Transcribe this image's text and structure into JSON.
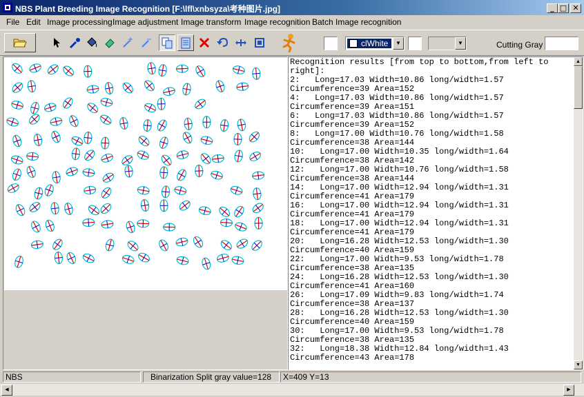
{
  "window": {
    "title": "NBS Plant Breeding Image Recognition [F:\\lfl\\xnbsyza\\考种图片.jpg]",
    "controls": {
      "minimize": "_",
      "maximize": "□",
      "close": "✕"
    }
  },
  "menu": [
    "File",
    "Edit",
    "Image processing",
    "Image adjustment",
    "Image transform",
    "Image recognition",
    "Batch Image recognition"
  ],
  "toolbar": {
    "icons": [
      "open-folder-icon",
      "pointer-icon",
      "eyedropper-icon",
      "paint-bucket-icon",
      "eraser-icon",
      "magic-wand-add-icon",
      "magic-wand-remove-icon",
      "copy-icon",
      "paste-icon",
      "delete-icon",
      "undo-icon",
      "move-icon",
      "fit-icon",
      "run-figure-icon"
    ],
    "color_combo_value": "clWhite",
    "cutting_gray_label": "Cutting Gray",
    "cutting_gray_value": ""
  },
  "results": {
    "lines": [
      "Recognition results [from top to bottom,from left to",
      "right]:",
      "2:   Long=17.03 Width=10.86 long/width=1.57",
      "Circumference=39 Area=152",
      "4:   Long=17.03 Width=10.86 long/width=1.57",
      "Circumference=39 Area=151",
      "6:   Long=17.03 Width=10.86 long/width=1.57",
      "Circumference=39 Area=152",
      "8:   Long=17.00 Width=10.76 long/width=1.58",
      "Circumference=38 Area=144",
      "10:   Long=17.00 Width=10.35 long/width=1.64",
      "Circumference=38 Area=142",
      "12:   Long=17.00 Width=10.76 long/width=1.58",
      "Circumference=38 Area=144",
      "14:   Long=17.00 Width=12.94 long/width=1.31",
      "Circumference=41 Area=179",
      "16:   Long=17.00 Width=12.94 long/width=1.31",
      "Circumference=41 Area=179",
      "18:   Long=17.00 Width=12.94 long/width=1.31",
      "Circumference=41 Area=179",
      "20:   Long=16.28 Width=12.53 long/width=1.30",
      "Circumference=40 Area=159",
      "22:   Long=17.00 Width=9.53 long/width=1.78",
      "Circumference=38 Area=135",
      "24:   Long=16.28 Width=12.53 long/width=1.30",
      "Circumference=41 Area=160",
      "26:   Long=17.09 Width=9.83 long/width=1.74",
      "Circumference=38 Area=137",
      "28:   Long=16.28 Width=12.53 long/width=1.30",
      "Circumference=40 Area=159",
      "30:   Long=17.00 Width=9.53 long/width=1.78",
      "Circumference=38 Area=135",
      "32:   Long=18.38 Width=12.84 long/width=1.43",
      "Circumference=43 Area=178"
    ]
  },
  "status": {
    "panel1": "NBS",
    "panel2": "Binarization Split gray value=128",
    "panel3": "X=409  Y=13"
  },
  "colors": {
    "title_gradient_start": "#0a246a",
    "seed_outline": "#00bcd4",
    "seed_long_axis": "#e00000",
    "seed_short_axis": "#0000cc",
    "chrome": "#d4d0c8"
  }
}
